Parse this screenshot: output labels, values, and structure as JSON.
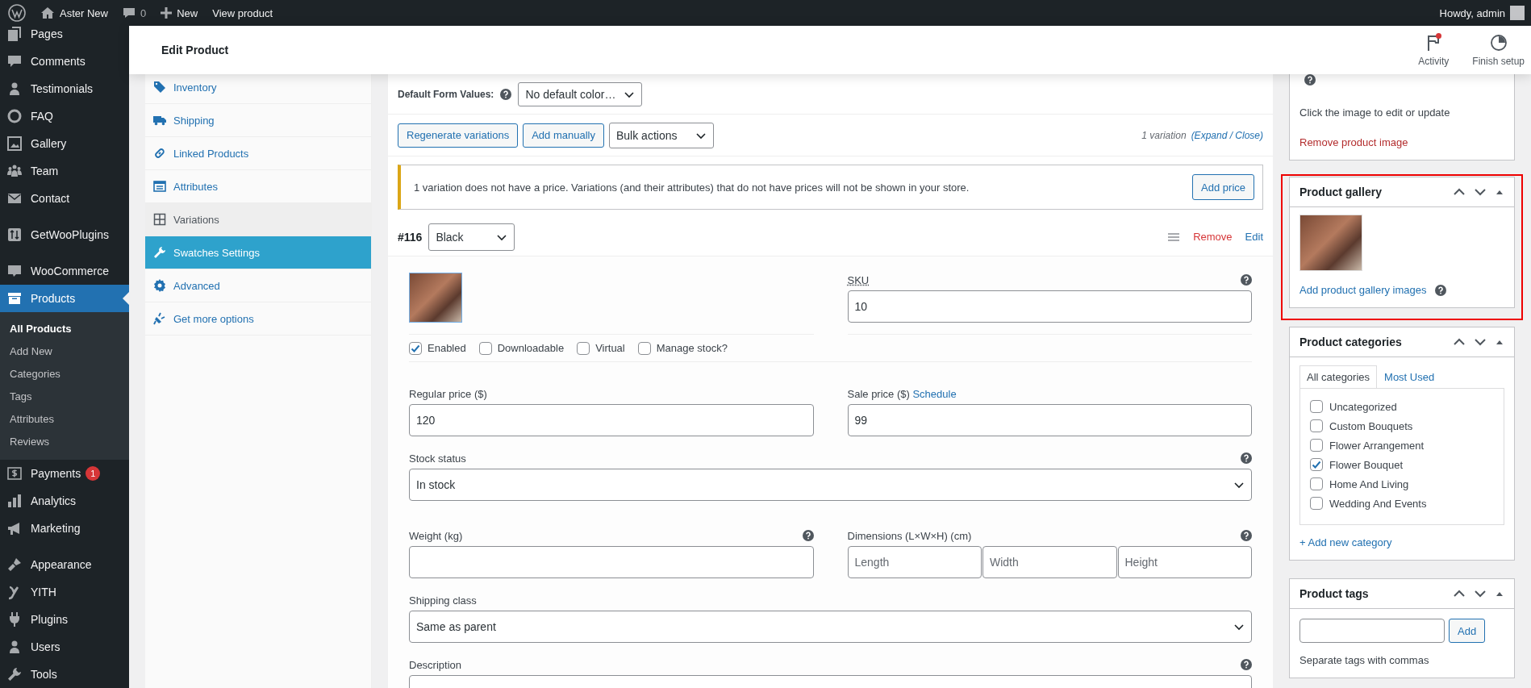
{
  "admin_bar": {
    "site": "Aster New",
    "comments": "0",
    "new": "New",
    "view": "View product",
    "greeting": "Howdy, admin"
  },
  "sidebar": {
    "groups": [
      [
        {
          "label": "Pages",
          "selected": false
        },
        {
          "label": "Comments",
          "selected": false
        },
        {
          "label": "Testimonials",
          "selected": false
        },
        {
          "label": "FAQ",
          "selected": false
        },
        {
          "label": "Gallery",
          "selected": false
        },
        {
          "label": "Team",
          "selected": false
        },
        {
          "label": "Contact",
          "selected": false
        }
      ],
      [
        {
          "label": "GetWooPlugins",
          "selected": false
        }
      ],
      [
        {
          "label": "WooCommerce",
          "selected": false
        },
        {
          "label": "Products",
          "selected": true,
          "submenu": [
            {
              "label": "All Products",
              "selected": true
            },
            {
              "label": "Add New",
              "selected": false
            },
            {
              "label": "Categories",
              "selected": false
            },
            {
              "label": "Tags",
              "selected": false
            },
            {
              "label": "Attributes",
              "selected": false
            },
            {
              "label": "Reviews",
              "selected": false
            }
          ]
        }
      ],
      [
        {
          "label": "Payments",
          "selected": false,
          "badge": "1"
        },
        {
          "label": "Analytics",
          "selected": false
        },
        {
          "label": "Marketing",
          "selected": false
        }
      ],
      [
        {
          "label": "Appearance",
          "selected": false
        },
        {
          "label": "YITH",
          "selected": false
        },
        {
          "label": "Plugins",
          "selected": false
        },
        {
          "label": "Users",
          "selected": false
        },
        {
          "label": "Tools",
          "selected": false
        }
      ]
    ]
  },
  "header": {
    "title": "Edit Product",
    "actions": [
      {
        "label": "Activity",
        "unread": true
      },
      {
        "label": "Finish setup",
        "unread": false
      }
    ]
  },
  "product_tabs": [
    {
      "label": "Inventory",
      "selected": false,
      "highlighted": false
    },
    {
      "label": "Shipping",
      "selected": false,
      "highlighted": false
    },
    {
      "label": "Linked Products",
      "selected": false,
      "highlighted": false
    },
    {
      "label": "Attributes",
      "selected": false,
      "highlighted": false
    },
    {
      "label": "Variations",
      "selected": true,
      "highlighted": false
    },
    {
      "label": "Swatches Settings",
      "selected": false,
      "highlighted": true
    },
    {
      "label": "Advanced",
      "selected": false,
      "highlighted": false
    },
    {
      "label": "Get more options",
      "selected": false,
      "highlighted": false
    }
  ],
  "variations": {
    "default_form": {
      "label": "Default Form Values:",
      "value": "No default color…"
    },
    "toolbar": {
      "buttons": [
        "Regenerate variations",
        "Add manually"
      ],
      "bulk": "Bulk actions",
      "count": "1 variation",
      "expand_close": "(Expand / Close)"
    },
    "notice": {
      "text": "1 variation does not have a price. Variations (and their attributes) that do not have prices will not be shown in your store.",
      "button": "Add price"
    },
    "variation": {
      "number": "#116",
      "value": "Black",
      "remove": "Remove",
      "edit": "Edit",
      "sku": {
        "label": "SKU",
        "value": "10"
      },
      "options": [
        {
          "label": "Enabled",
          "checked": true
        },
        {
          "label": "Downloadable",
          "checked": false
        },
        {
          "label": "Virtual",
          "checked": false
        },
        {
          "label": "Manage stock?",
          "checked": false
        }
      ],
      "regular_price": {
        "label": "Regular price ($)",
        "value": "120"
      },
      "sale_price": {
        "label": "Sale price ($)",
        "link": "Schedule",
        "value": "99"
      },
      "stock_status": {
        "label": "Stock status",
        "value": "In stock"
      },
      "weight": {
        "label": "Weight (kg)"
      },
      "dimensions": {
        "label": "Dimensions (L×W×H) (cm)",
        "placeholders": [
          "Length",
          "Width",
          "Height"
        ]
      },
      "shipping_class": {
        "label": "Shipping class",
        "value": "Same as parent"
      },
      "description": {
        "label": "Description"
      }
    }
  },
  "side": {
    "featured_image": {
      "hint": "Click the image to edit or update",
      "remove_link": "Remove product image"
    },
    "gallery": {
      "title": "Product gallery",
      "highlighted": true,
      "add_link": "Add product gallery images"
    },
    "categories": {
      "title": "Product categories",
      "tabs": [
        {
          "label": "All categories",
          "selected": true
        },
        {
          "label": "Most Used",
          "selected": false
        }
      ],
      "items": [
        {
          "label": "Uncategorized",
          "checked": false
        },
        {
          "label": "Custom Bouquets",
          "checked": false
        },
        {
          "label": "Flower Arrangement",
          "checked": false
        },
        {
          "label": "Flower Bouquet",
          "checked": true
        },
        {
          "label": "Home And Living",
          "checked": false
        },
        {
          "label": "Wedding And Events",
          "checked": false
        }
      ],
      "add_link": "+ Add new category"
    },
    "tags": {
      "title": "Product tags",
      "button": "Add",
      "hint": "Separate tags with commas"
    }
  }
}
